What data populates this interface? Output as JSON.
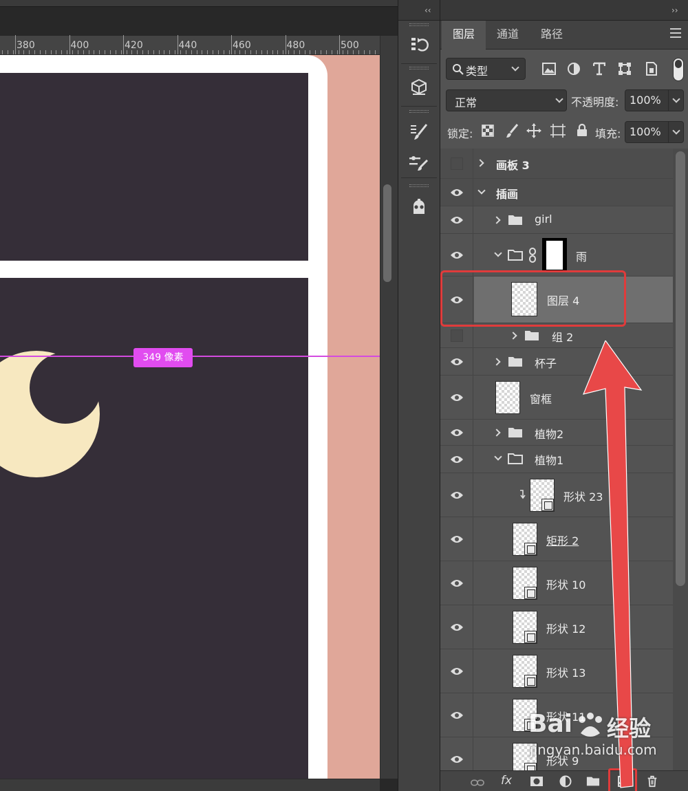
{
  "ruler": {
    "ticks": [
      "380",
      "400",
      "420",
      "440",
      "460",
      "480",
      "500"
    ]
  },
  "canvas": {
    "guide_badge": "349 像素"
  },
  "tool_strip": {
    "collapse": "‹‹"
  },
  "panel": {
    "collapse": "››",
    "tabs": [
      {
        "label": "图层",
        "active": true
      },
      {
        "label": "通道",
        "active": false
      },
      {
        "label": "路径",
        "active": false
      }
    ],
    "filter": {
      "icon": "search-icon",
      "label": "类型"
    },
    "blend_mode": "正常",
    "opacity_label": "不透明度:",
    "opacity_value": "100%",
    "lock_label": "锁定:",
    "fill_label": "填充:",
    "fill_value": "100%",
    "layers": [
      {
        "name": "画板 3",
        "visible": false,
        "kind": "artboard",
        "expanded": false
      },
      {
        "name": "插画",
        "visible": true,
        "kind": "artboard",
        "expanded": true
      },
      {
        "name": "girl",
        "visible": true,
        "kind": "group",
        "expanded": false
      },
      {
        "name": "雨",
        "visible": true,
        "kind": "group-mask",
        "expanded": true
      },
      {
        "name": "图层 4",
        "visible": true,
        "kind": "pixel",
        "selected": true
      },
      {
        "name": "组 2",
        "visible": false,
        "kind": "group",
        "expanded": false
      },
      {
        "name": "杯子",
        "visible": true,
        "kind": "group",
        "expanded": false
      },
      {
        "name": "窗框",
        "visible": true,
        "kind": "pixel"
      },
      {
        "name": "植物2",
        "visible": true,
        "kind": "group",
        "expanded": false
      },
      {
        "name": "植物1",
        "visible": true,
        "kind": "group",
        "expanded": true
      },
      {
        "name": "形状 23",
        "visible": true,
        "kind": "shape-clipped"
      },
      {
        "name": "矩形 2",
        "visible": true,
        "kind": "shape"
      },
      {
        "name": "形状 10",
        "visible": true,
        "kind": "shape"
      },
      {
        "name": "形状 12",
        "visible": true,
        "kind": "shape"
      },
      {
        "name": "形状 13",
        "visible": true,
        "kind": "shape"
      },
      {
        "name": "形状 11",
        "visible": true,
        "kind": "shape"
      },
      {
        "name": "形状 9",
        "visible": true,
        "kind": "shape"
      }
    ],
    "footer_fx": "fx"
  },
  "watermark": {
    "brand": "Bai",
    "brand2": "经验",
    "url": "jingyan.baidu.com"
  },
  "colors": {
    "highlight": "#e03b3b",
    "guide": "#e14cf0",
    "moon": "#f7e8c0",
    "pane": "#352e38",
    "backdrop": "#e0a799"
  }
}
